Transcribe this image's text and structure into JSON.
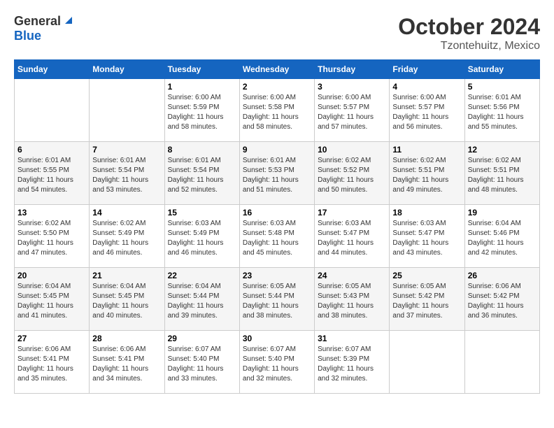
{
  "header": {
    "logo": {
      "general": "General",
      "blue": "Blue"
    },
    "title": "October 2024",
    "subtitle": "Tzontehuitz, Mexico"
  },
  "weekdays": [
    "Sunday",
    "Monday",
    "Tuesday",
    "Wednesday",
    "Thursday",
    "Friday",
    "Saturday"
  ],
  "weeks": [
    [
      {
        "day": "",
        "info": ""
      },
      {
        "day": "",
        "info": ""
      },
      {
        "day": "1",
        "sunrise": "Sunrise: 6:00 AM",
        "sunset": "Sunset: 5:59 PM",
        "daylight": "Daylight: 11 hours and 58 minutes."
      },
      {
        "day": "2",
        "sunrise": "Sunrise: 6:00 AM",
        "sunset": "Sunset: 5:58 PM",
        "daylight": "Daylight: 11 hours and 58 minutes."
      },
      {
        "day": "3",
        "sunrise": "Sunrise: 6:00 AM",
        "sunset": "Sunset: 5:57 PM",
        "daylight": "Daylight: 11 hours and 57 minutes."
      },
      {
        "day": "4",
        "sunrise": "Sunrise: 6:00 AM",
        "sunset": "Sunset: 5:57 PM",
        "daylight": "Daylight: 11 hours and 56 minutes."
      },
      {
        "day": "5",
        "sunrise": "Sunrise: 6:01 AM",
        "sunset": "Sunset: 5:56 PM",
        "daylight": "Daylight: 11 hours and 55 minutes."
      }
    ],
    [
      {
        "day": "6",
        "sunrise": "Sunrise: 6:01 AM",
        "sunset": "Sunset: 5:55 PM",
        "daylight": "Daylight: 11 hours and 54 minutes."
      },
      {
        "day": "7",
        "sunrise": "Sunrise: 6:01 AM",
        "sunset": "Sunset: 5:54 PM",
        "daylight": "Daylight: 11 hours and 53 minutes."
      },
      {
        "day": "8",
        "sunrise": "Sunrise: 6:01 AM",
        "sunset": "Sunset: 5:54 PM",
        "daylight": "Daylight: 11 hours and 52 minutes."
      },
      {
        "day": "9",
        "sunrise": "Sunrise: 6:01 AM",
        "sunset": "Sunset: 5:53 PM",
        "daylight": "Daylight: 11 hours and 51 minutes."
      },
      {
        "day": "10",
        "sunrise": "Sunrise: 6:02 AM",
        "sunset": "Sunset: 5:52 PM",
        "daylight": "Daylight: 11 hours and 50 minutes."
      },
      {
        "day": "11",
        "sunrise": "Sunrise: 6:02 AM",
        "sunset": "Sunset: 5:51 PM",
        "daylight": "Daylight: 11 hours and 49 minutes."
      },
      {
        "day": "12",
        "sunrise": "Sunrise: 6:02 AM",
        "sunset": "Sunset: 5:51 PM",
        "daylight": "Daylight: 11 hours and 48 minutes."
      }
    ],
    [
      {
        "day": "13",
        "sunrise": "Sunrise: 6:02 AM",
        "sunset": "Sunset: 5:50 PM",
        "daylight": "Daylight: 11 hours and 47 minutes."
      },
      {
        "day": "14",
        "sunrise": "Sunrise: 6:02 AM",
        "sunset": "Sunset: 5:49 PM",
        "daylight": "Daylight: 11 hours and 46 minutes."
      },
      {
        "day": "15",
        "sunrise": "Sunrise: 6:03 AM",
        "sunset": "Sunset: 5:49 PM",
        "daylight": "Daylight: 11 hours and 46 minutes."
      },
      {
        "day": "16",
        "sunrise": "Sunrise: 6:03 AM",
        "sunset": "Sunset: 5:48 PM",
        "daylight": "Daylight: 11 hours and 45 minutes."
      },
      {
        "day": "17",
        "sunrise": "Sunrise: 6:03 AM",
        "sunset": "Sunset: 5:47 PM",
        "daylight": "Daylight: 11 hours and 44 minutes."
      },
      {
        "day": "18",
        "sunrise": "Sunrise: 6:03 AM",
        "sunset": "Sunset: 5:47 PM",
        "daylight": "Daylight: 11 hours and 43 minutes."
      },
      {
        "day": "19",
        "sunrise": "Sunrise: 6:04 AM",
        "sunset": "Sunset: 5:46 PM",
        "daylight": "Daylight: 11 hours and 42 minutes."
      }
    ],
    [
      {
        "day": "20",
        "sunrise": "Sunrise: 6:04 AM",
        "sunset": "Sunset: 5:45 PM",
        "daylight": "Daylight: 11 hours and 41 minutes."
      },
      {
        "day": "21",
        "sunrise": "Sunrise: 6:04 AM",
        "sunset": "Sunset: 5:45 PM",
        "daylight": "Daylight: 11 hours and 40 minutes."
      },
      {
        "day": "22",
        "sunrise": "Sunrise: 6:04 AM",
        "sunset": "Sunset: 5:44 PM",
        "daylight": "Daylight: 11 hours and 39 minutes."
      },
      {
        "day": "23",
        "sunrise": "Sunrise: 6:05 AM",
        "sunset": "Sunset: 5:44 PM",
        "daylight": "Daylight: 11 hours and 38 minutes."
      },
      {
        "day": "24",
        "sunrise": "Sunrise: 6:05 AM",
        "sunset": "Sunset: 5:43 PM",
        "daylight": "Daylight: 11 hours and 38 minutes."
      },
      {
        "day": "25",
        "sunrise": "Sunrise: 6:05 AM",
        "sunset": "Sunset: 5:42 PM",
        "daylight": "Daylight: 11 hours and 37 minutes."
      },
      {
        "day": "26",
        "sunrise": "Sunrise: 6:06 AM",
        "sunset": "Sunset: 5:42 PM",
        "daylight": "Daylight: 11 hours and 36 minutes."
      }
    ],
    [
      {
        "day": "27",
        "sunrise": "Sunrise: 6:06 AM",
        "sunset": "Sunset: 5:41 PM",
        "daylight": "Daylight: 11 hours and 35 minutes."
      },
      {
        "day": "28",
        "sunrise": "Sunrise: 6:06 AM",
        "sunset": "Sunset: 5:41 PM",
        "daylight": "Daylight: 11 hours and 34 minutes."
      },
      {
        "day": "29",
        "sunrise": "Sunrise: 6:07 AM",
        "sunset": "Sunset: 5:40 PM",
        "daylight": "Daylight: 11 hours and 33 minutes."
      },
      {
        "day": "30",
        "sunrise": "Sunrise: 6:07 AM",
        "sunset": "Sunset: 5:40 PM",
        "daylight": "Daylight: 11 hours and 32 minutes."
      },
      {
        "day": "31",
        "sunrise": "Sunrise: 6:07 AM",
        "sunset": "Sunset: 5:39 PM",
        "daylight": "Daylight: 11 hours and 32 minutes."
      },
      {
        "day": "",
        "info": ""
      },
      {
        "day": "",
        "info": ""
      }
    ]
  ]
}
